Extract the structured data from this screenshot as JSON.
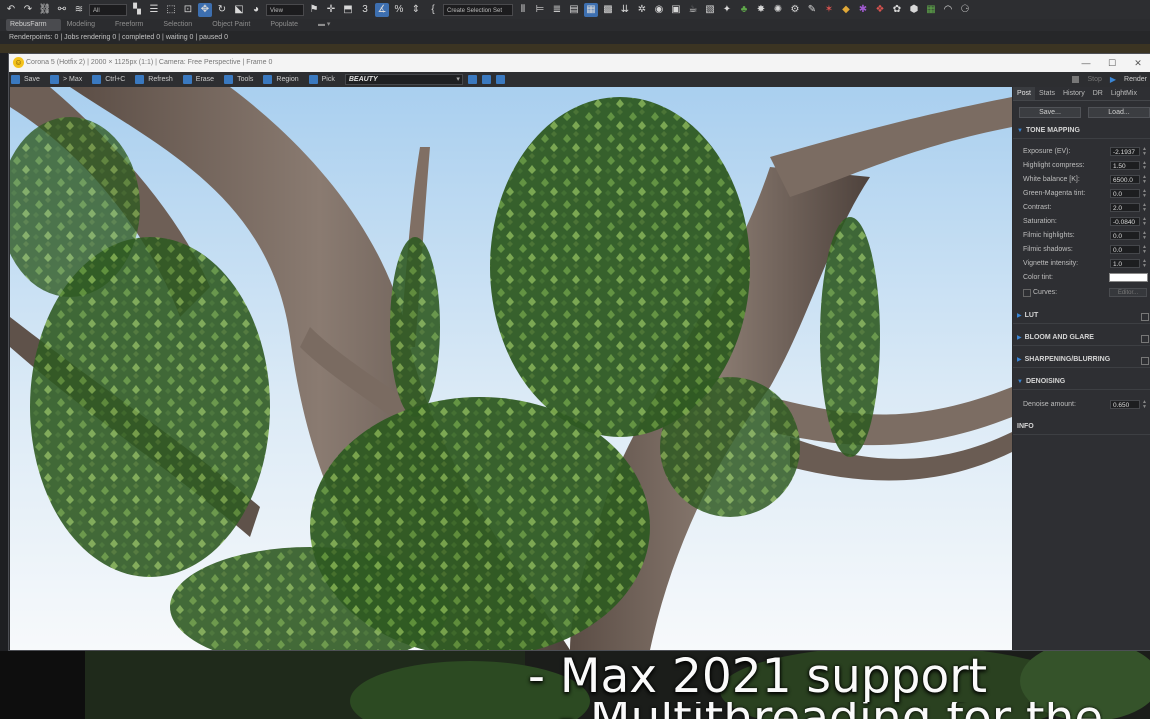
{
  "max_toolbar": {
    "selection_filter": "All",
    "view_dropdown": "View",
    "named_selection": "Create Selection Set",
    "icons": [
      "undo-icon",
      "redo-icon",
      "link-icon",
      "unlink-icon",
      "bind-spacewarp-icon",
      "select-object-icon",
      "select-by-name-icon",
      "rect-region-icon",
      "window-crossing-icon",
      "select-move-icon",
      "select-rotate-icon",
      "select-scale-icon",
      "place-icon",
      "snap-icon",
      "angle-snap-icon",
      "percent-snap-icon",
      "spinner-snap-icon",
      "edit-named-sets-icon",
      "mirror-icon",
      "align-icon",
      "layer-explorer-icon",
      "ribbon-icon",
      "curve-editor-icon",
      "schematic-view-icon",
      "material-editor-icon",
      "render-setup-icon",
      "render-frame-icon",
      "render-icon",
      "plugin-icon"
    ]
  },
  "ribbon_tabs": [
    "RebusFarm",
    "Modeling",
    "Freeform",
    "Selection",
    "Object Paint",
    "Populate"
  ],
  "status_line": "Renderpoints: 0 | Jobs rendering 0 | completed 0 | waiting 0 | paused 0",
  "vfb": {
    "title": "Corona 5 (Hotfix 2) | 2000 × 1125px (1:1) | Camera: Free Perspective | Frame 0",
    "toolbar": [
      "Save",
      "> Max",
      "Ctrl+C",
      "Refresh",
      "Erase",
      "Tools",
      "Region",
      "Pick"
    ],
    "render_pass": "BEAUTY",
    "stop_label": "Stop",
    "render_label": "Render"
  },
  "panel": {
    "tabs": [
      "Post",
      "Stats",
      "History",
      "DR",
      "LightMix"
    ],
    "save_btn": "Save...",
    "load_btn": "Load...",
    "tone_mapping_header": "TONE MAPPING",
    "tone_mapping": [
      {
        "label": "Exposure (EV):",
        "value": "-2.1937"
      },
      {
        "label": "Highlight compress:",
        "value": "1.50"
      },
      {
        "label": "White balance [K]:",
        "value": "6500.0"
      },
      {
        "label": "Green-Magenta tint:",
        "value": "0.0"
      },
      {
        "label": "Contrast:",
        "value": "2.0"
      },
      {
        "label": "Saturation:",
        "value": "-0.0840"
      },
      {
        "label": "Filmic highlights:",
        "value": "0.0"
      },
      {
        "label": "Filmic shadows:",
        "value": "0.0"
      },
      {
        "label": "Vignette intensity:",
        "value": "1.0"
      }
    ],
    "color_tint_label": "Color tint:",
    "curves_label": "Curves:",
    "editor_btn": "Editor...",
    "lut_header": "LUT",
    "bloom_header": "BLOOM AND GLARE",
    "sharpen_header": "SHARPENING/BLURRING",
    "denoise_header": "DENOISING",
    "denoise_label": "Denoise amount:",
    "denoise_value": "0.650",
    "info_header": "INFO"
  },
  "captions": {
    "line1": "- Max 2021 support",
    "line2": "- Multithreading for the"
  }
}
